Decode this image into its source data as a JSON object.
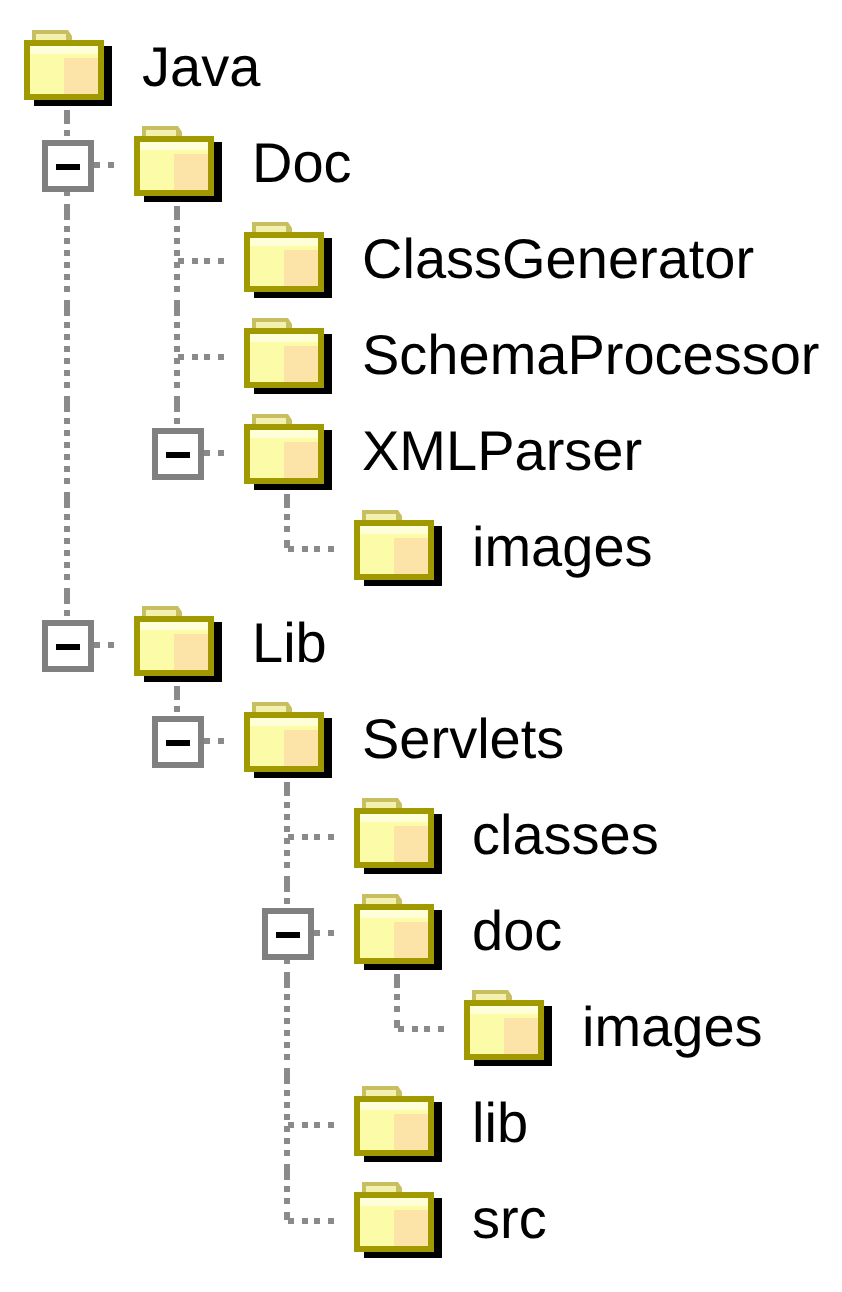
{
  "tree": [
    {
      "label": "Java",
      "children": [
        {
          "label": "Doc",
          "expanded": true,
          "children": [
            {
              "label": "ClassGenerator"
            },
            {
              "label": "SchemaProcessor"
            },
            {
              "label": "XMLParser",
              "expanded": true,
              "children": [
                {
                  "label": "images"
                }
              ]
            }
          ]
        },
        {
          "label": "Lib",
          "expanded": true,
          "children": [
            {
              "label": "Servlets",
              "expanded": true,
              "children": [
                {
                  "label": "classes"
                },
                {
                  "label": "doc",
                  "expanded": true,
                  "children": [
                    {
                      "label": "images"
                    }
                  ]
                },
                {
                  "label": "lib"
                },
                {
                  "label": "src"
                }
              ]
            }
          ]
        }
      ]
    }
  ]
}
